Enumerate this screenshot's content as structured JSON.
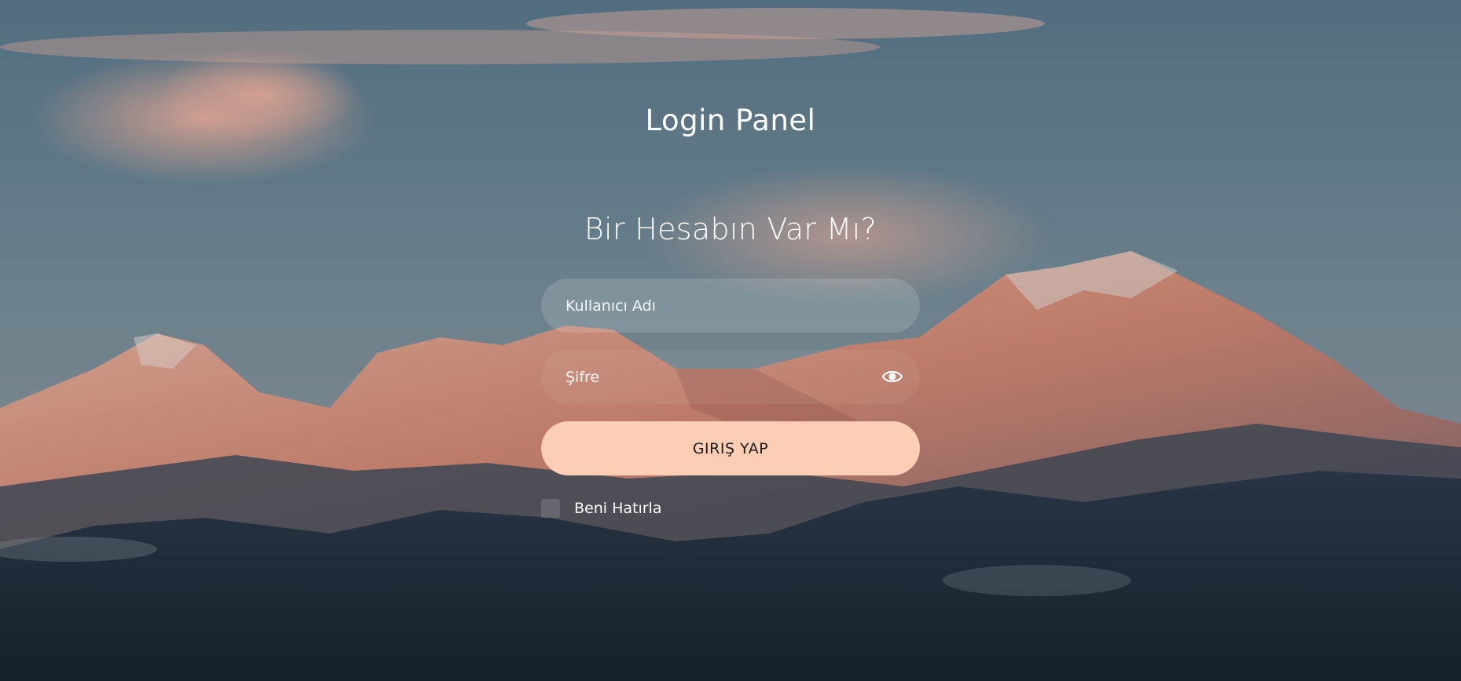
{
  "page": {
    "title": "Login Panel",
    "subtitle": "Bir Hesabın Var Mı?"
  },
  "form": {
    "username": {
      "placeholder": "Kullanıcı Adı",
      "value": ""
    },
    "password": {
      "placeholder": "Şifre",
      "value": ""
    },
    "submit_label": "GIRIŞ YAP",
    "remember_label": "Beni Hatırla",
    "remember_checked": false
  },
  "icons": {
    "password_toggle": "eye-icon"
  },
  "colors": {
    "button_bg": "#fbceb5",
    "text": "#ffffff"
  }
}
